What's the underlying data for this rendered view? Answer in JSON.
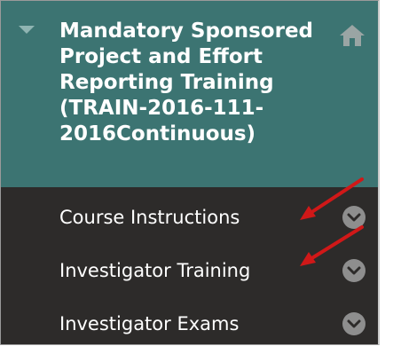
{
  "course": {
    "title": "Mandatory Sponsored\nProject and Effort\nReporting Training\n(TRAIN-2016-111-\n2016Continuous)",
    "toggle_icon": "triangle-down-icon",
    "home_icon": "home-icon"
  },
  "menu": {
    "items": [
      {
        "label": "Course Instructions",
        "options_icon": "chevron-down-circle-icon"
      },
      {
        "label": "Investigator Training",
        "options_icon": "chevron-down-circle-icon"
      },
      {
        "label": "Investigator Exams",
        "options_icon": "chevron-down-circle-icon"
      }
    ]
  },
  "annotations": {
    "arrow_icon": "red-arrow-icon",
    "arrow_color": "#d01818"
  },
  "colors": {
    "header_bg": "#3c7472",
    "menu_bg": "#2d2b2a",
    "text": "#ffffff",
    "icon_gray": "#8e8e8e"
  }
}
